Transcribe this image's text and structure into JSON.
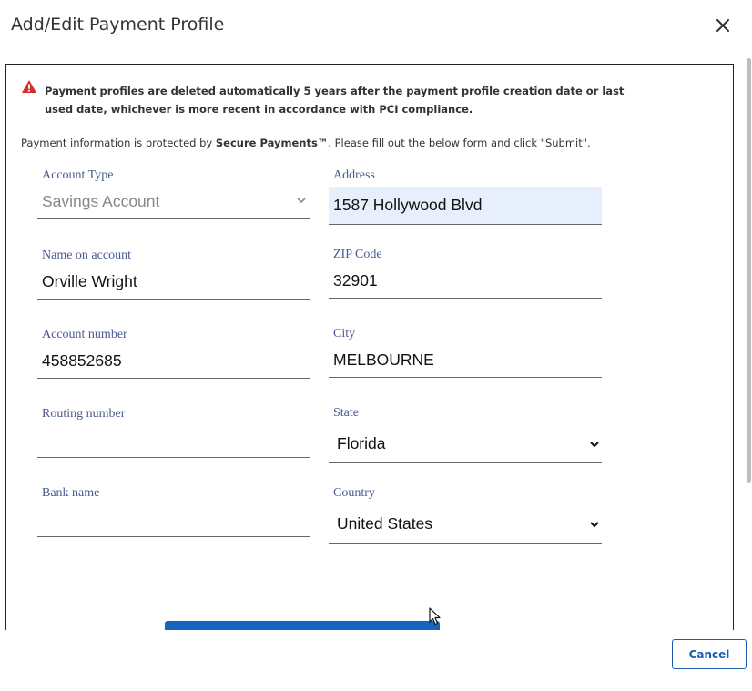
{
  "dialog": {
    "title": "Add/Edit Payment Profile",
    "close_icon": "close-icon"
  },
  "notice": {
    "icon": "warning-triangle-icon",
    "warning_text": "Payment profiles are deleted automatically 5 years after the payment profile creation date or last used date, whichever is more recent in accordance with PCI compliance.",
    "info_prefix": "Payment information is protected by ",
    "info_brand": "Secure Payments™",
    "info_suffix": ". Please fill out the below form and click \"Submit\"."
  },
  "form": {
    "account_type": {
      "label": "Account Type",
      "value": "Savings Account"
    },
    "name_on_account": {
      "label": "Name on account",
      "value": "Orville Wright"
    },
    "account_number": {
      "label": "Account number",
      "value": "458852685"
    },
    "routing_number": {
      "label": "Routing number",
      "value": ""
    },
    "bank_name": {
      "label": "Bank name",
      "value": ""
    },
    "address": {
      "label": "Address",
      "value": "1587 Hollywood Blvd"
    },
    "zip_code": {
      "label": "ZIP Code",
      "value": "32901"
    },
    "city": {
      "label": "City",
      "value": "MELBOURNE"
    },
    "state": {
      "label": "State",
      "value": "Florida"
    },
    "country": {
      "label": "Country",
      "value": "United States"
    }
  },
  "footer": {
    "cancel_label": "Cancel"
  },
  "colors": {
    "accent": "#1565c0",
    "label": "#4a5a8e",
    "warning": "#d32f2f",
    "highlight": "#e8effc"
  }
}
